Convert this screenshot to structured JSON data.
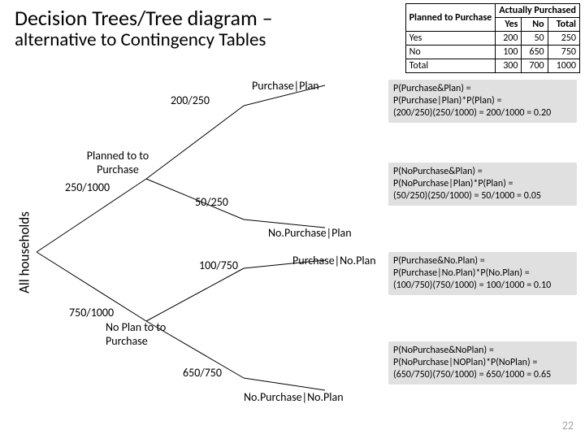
{
  "header": {
    "title_line1": "Decision Trees/Tree diagram –",
    "title_line2": "alternative to Contingency Tables"
  },
  "contingency_table": {
    "col_group": "Actually Purchased",
    "row_header": "Planned to Purchase",
    "cols": {
      "yes": "Yes",
      "no": "No",
      "total": "Total"
    },
    "rows": {
      "yes": {
        "label": "Yes",
        "yes": "200",
        "no": "50",
        "total": "250"
      },
      "no": {
        "label": "No",
        "yes": "100",
        "no": "650",
        "total": "750"
      },
      "total": {
        "label": "Total",
        "yes": "300",
        "no": "700",
        "total": "1000"
      }
    }
  },
  "tree": {
    "root_label": "All households",
    "branch_plan": {
      "frac": "250/1000",
      "label": "Planned to to Purchase",
      "leaf_yes": {
        "frac": "200/250",
        "label": "Purchase|Plan"
      },
      "leaf_no": {
        "frac": "50/250",
        "label": "No.Purchase|Plan"
      }
    },
    "branch_noplan": {
      "frac": "750/1000",
      "label": "No Plan to to Purchase",
      "leaf_yes": {
        "frac": "100/750",
        "label": "Purchase|No.Plan"
      },
      "leaf_no": {
        "frac": "650/750",
        "label": "No.Purchase|No.Plan"
      }
    }
  },
  "formulas": {
    "a": "P(Purchase&Plan) =\nP(Purchase|Plan)*P(Plan) =\n(200/250)(250/1000) = 200/1000 = 0.20",
    "b": "P(NoPurchase&Plan) =\nP(NoPurchase|Plan)*P(Plan) =\n(50/250)(250/1000) = 50/1000 = 0.05",
    "c": "P(Purchase&No.Plan) =\nP(Purchase|No.Plan)*P(No.Plan) =\n(100/750)(750/1000) = 100/1000 = 0.10",
    "d": "P(NoPurchase&NoPlan) =\nP(NoPurchase|NOPlan)*P(NoPlan) =\n(650/750)(750/1000) = 650/1000 = 0.65"
  },
  "page_number": "22"
}
